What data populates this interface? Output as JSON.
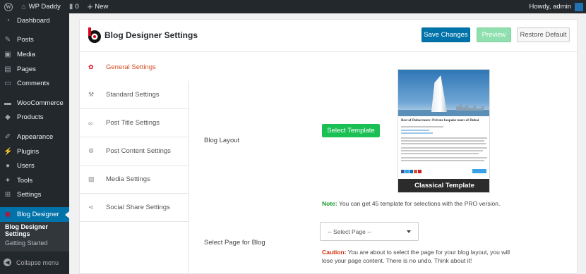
{
  "adminbar": {
    "site_name": "WP Daddy",
    "comments_count": "0",
    "new_label": "New",
    "howdy": "Howdy, admin"
  },
  "menu": {
    "items": [
      {
        "label": "Dashboard",
        "icon": "dashboard-icon"
      },
      {
        "label": "Posts",
        "icon": "pin-icon"
      },
      {
        "label": "Media",
        "icon": "media-icon"
      },
      {
        "label": "Pages",
        "icon": "page-icon"
      },
      {
        "label": "Comments",
        "icon": "comment-icon"
      },
      {
        "label": "WooCommerce",
        "icon": "woocommerce-icon"
      },
      {
        "label": "Products",
        "icon": "box-icon"
      },
      {
        "label": "Appearance",
        "icon": "brush-icon"
      },
      {
        "label": "Plugins",
        "icon": "plug-icon"
      },
      {
        "label": "Users",
        "icon": "user-icon"
      },
      {
        "label": "Tools",
        "icon": "wrench-icon"
      },
      {
        "label": "Settings",
        "icon": "sliders-icon"
      },
      {
        "label": "Blog Designer",
        "icon": "blog-designer-icon"
      }
    ],
    "submenu": [
      "Blog Designer Settings",
      "Getting Started"
    ],
    "collapse": "Collapse menu"
  },
  "panel": {
    "title": "Blog Designer Settings",
    "save": "Save Changes",
    "preview": "Preview",
    "restore": "Restore Default"
  },
  "tabs": [
    {
      "label": "General Settings",
      "icon": "gear-icon"
    },
    {
      "label": "Standard Settings",
      "icon": "hammer-icon"
    },
    {
      "label": "Post Title Settings",
      "icon": "link-icon"
    },
    {
      "label": "Post Content Settings",
      "icon": "gears-icon"
    },
    {
      "label": "Media Settings",
      "icon": "image-icon"
    },
    {
      "label": "Social Share Settings",
      "icon": "share-icon"
    }
  ],
  "general": {
    "blog_layout_label": "Blog Layout",
    "select_template": "Select Template",
    "template_preview_title": "Best of  Dubai tours: Private bespoke tours of  Dubai",
    "template_name": "Classical Template",
    "note_prefix": "Note:",
    "note_text": " You can get 45 template for selections with the PRO version.",
    "select_page_label": "Select Page for Blog",
    "select_page_value": "-- Select Page --",
    "caution_prefix": "Caution:",
    "caution_text": " You are about to select the page for your blog layout, you will lose your page content. There is no undo. Think about it!"
  },
  "colors": {
    "admin_dark": "#23282d",
    "accent_blue": "#0073aa",
    "green": "#1bc054",
    "preview_green": "#8fe0ae",
    "tab_active": "#d54e21"
  }
}
